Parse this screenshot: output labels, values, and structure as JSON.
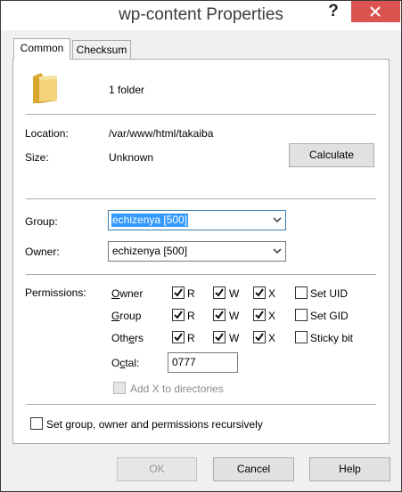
{
  "window": {
    "title": "wp-content Properties",
    "help_glyph": "?",
    "close_icon": "close-icon"
  },
  "tabs": [
    {
      "label": "Common",
      "active": true
    },
    {
      "label": "Checksum",
      "active": false
    }
  ],
  "summary": {
    "item": "1 folder",
    "icon": "folder-icon"
  },
  "info": {
    "location_label": "Location:",
    "location_value": "/var/www/html/takaiba",
    "size_label": "Size:",
    "size_value": "Unknown",
    "calculate_label": "Calculate"
  },
  "ownership": {
    "group_label": "Group:",
    "group_value": "echizenya [500]",
    "owner_label": "Owner:",
    "owner_value": "echizenya [500]"
  },
  "permissions": {
    "label": "Permissions:",
    "rows": [
      {
        "name": "Owner",
        "mnemonic": "O",
        "rest": "wner",
        "r": true,
        "w": true,
        "x": true,
        "special": "Set UID",
        "special_checked": false
      },
      {
        "name": "Group",
        "mnemonic": "G",
        "rest": "roup",
        "r": true,
        "w": true,
        "x": true,
        "special": "Set GID",
        "special_checked": false
      },
      {
        "name": "Others",
        "pre": "Oth",
        "mnemonic": "e",
        "rest": "rs",
        "r": true,
        "w": true,
        "x": true,
        "special": "Sticky bit",
        "special_checked": false
      }
    ],
    "flag_r": "R",
    "flag_w": "W",
    "flag_x": "X",
    "octal_label_pre": "O",
    "octal_label_mnemonic": "c",
    "octal_label_rest": "tal:",
    "octal_value": "0777",
    "add_x_label": "Add X to directories",
    "add_x_checked": false,
    "add_x_enabled": false
  },
  "recursive": {
    "label": "Set group, owner and permissions recursively",
    "checked": false
  },
  "buttons": {
    "ok": "OK",
    "cancel": "Cancel",
    "help": "Help"
  },
  "colors": {
    "close": "#d9534f",
    "selection": "#3399ff",
    "dialog_bg": "#f0f0f0"
  }
}
